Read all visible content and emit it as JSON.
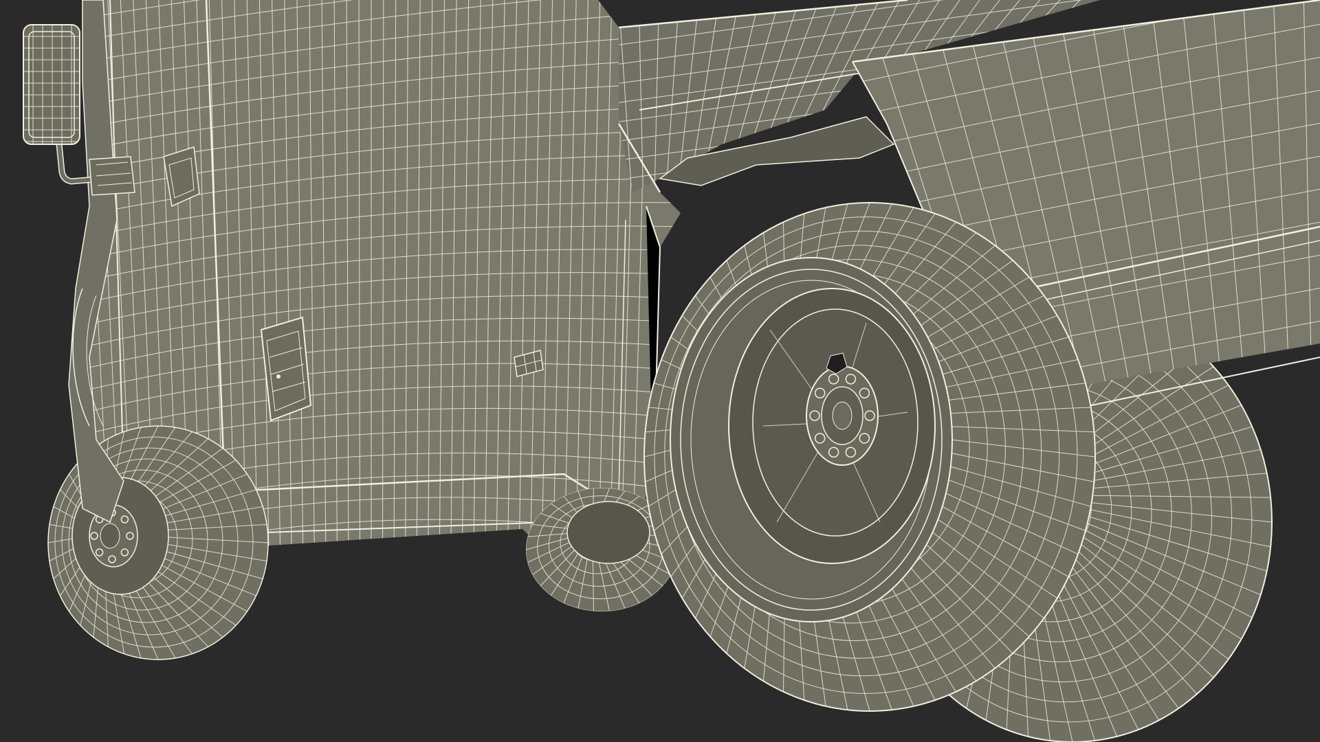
{
  "render": {
    "background_color": "#2a2a2a",
    "body_color": "#7a7a6c",
    "body_shadow_color": "#5e5e52",
    "tire_color": "#6f6f62",
    "tire_inner_color": "#56564b",
    "wire_color": "#f2f0df"
  }
}
